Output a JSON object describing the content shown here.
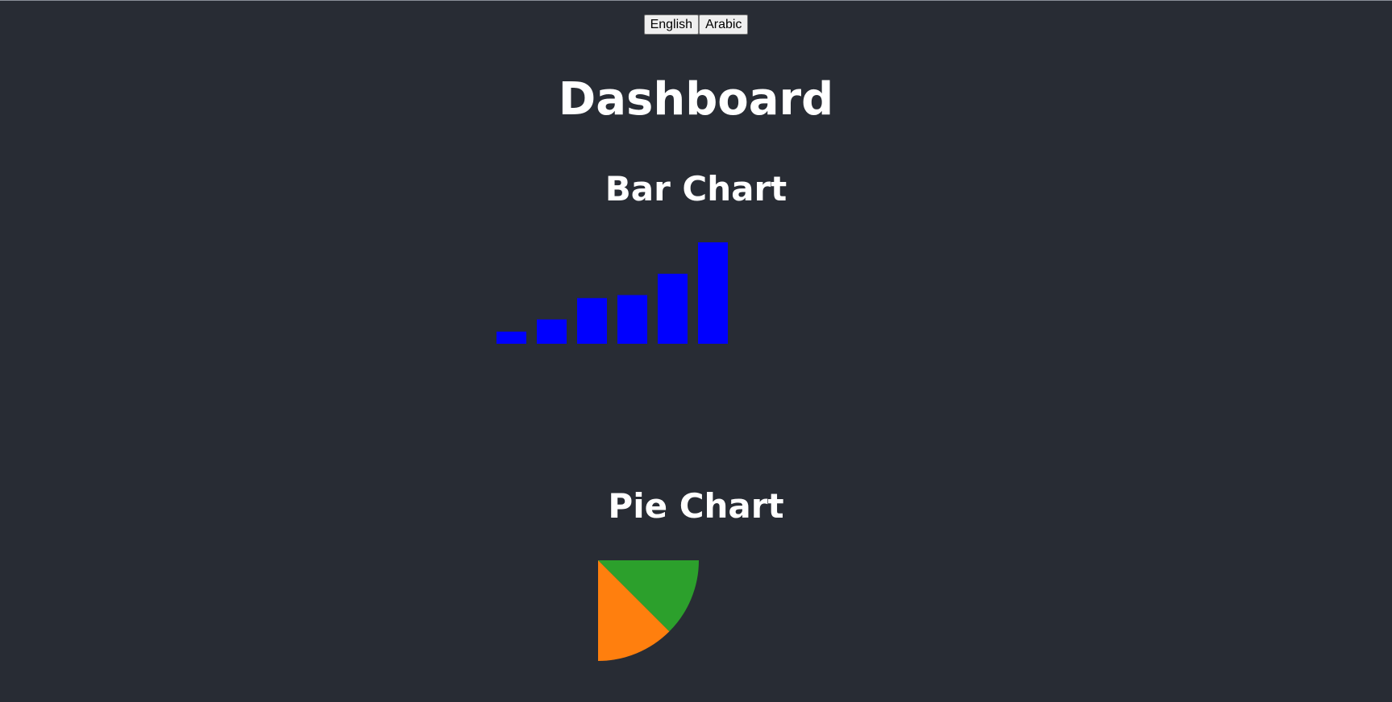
{
  "language_buttons": {
    "english": "English",
    "arabic": "Arabic"
  },
  "header": {
    "title": "Dashboard"
  },
  "sections": {
    "bar_title": "Bar Chart",
    "pie_title": "Pie Chart"
  },
  "chart_data": [
    {
      "type": "bar",
      "title": "Bar Chart",
      "categories": [
        "",
        "",
        "",
        "",
        "",
        ""
      ],
      "values": [
        12,
        24,
        45,
        48,
        69,
        100
      ],
      "color": "#0000ff"
    },
    {
      "type": "pie",
      "title": "Pie Chart",
      "slices": [
        {
          "value": 12.5,
          "color": "#2ca02c"
        },
        {
          "value": 12.5,
          "color": "#ff7f0e"
        }
      ],
      "total": 100
    }
  ]
}
